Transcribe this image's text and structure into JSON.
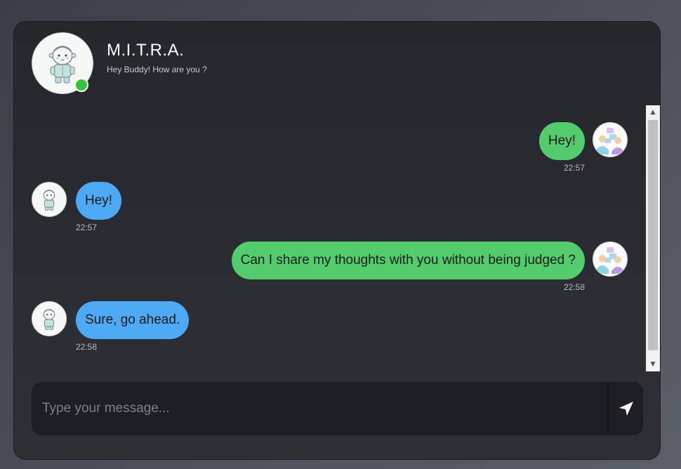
{
  "header": {
    "title": "M.I.T.R.A.",
    "subtitle": "Hey Buddy! How are you ?",
    "status": "online",
    "bot_avatar_icon": "baby-robot-icon"
  },
  "messages": [
    {
      "sender": "user",
      "text": "Hey!",
      "time": "22:57",
      "avatar_icon": "people-chat-icon"
    },
    {
      "sender": "bot",
      "text": "Hey!",
      "time": "22:57",
      "avatar_icon": "baby-robot-icon"
    },
    {
      "sender": "user",
      "text": "Can I share my thoughts with you without being judged ?",
      "time": "22:58",
      "avatar_icon": "people-chat-icon"
    },
    {
      "sender": "bot",
      "text": "Sure, go ahead.",
      "time": "22:58",
      "avatar_icon": "baby-robot-icon"
    }
  ],
  "composer": {
    "placeholder": "Type your message...",
    "value": "",
    "send_icon": "paper-plane-icon"
  },
  "colors": {
    "user_bubble": "#52cc6c",
    "bot_bubble": "#4ea9f5",
    "online": "#37c43c",
    "card_bg": "#25272d"
  }
}
